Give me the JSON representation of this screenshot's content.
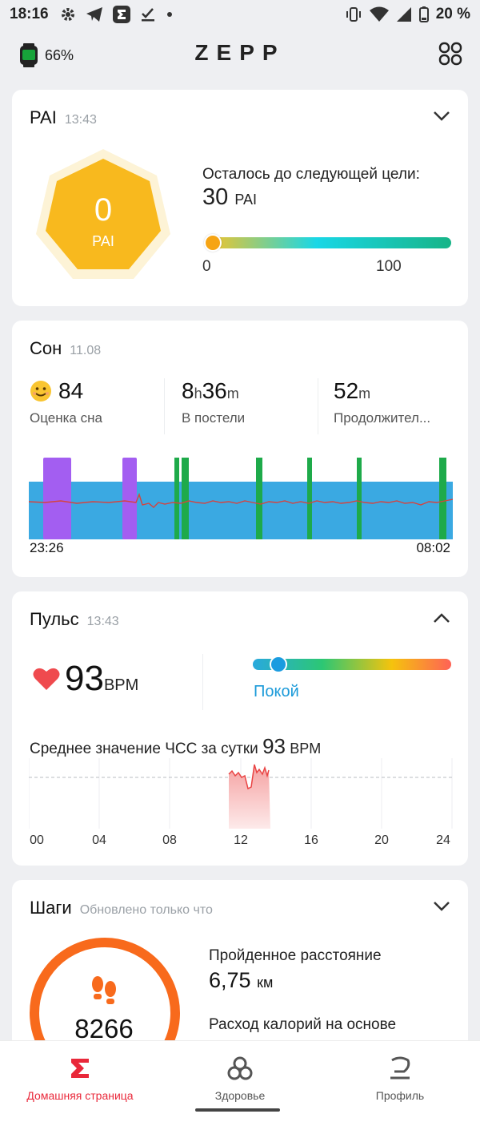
{
  "status": {
    "time": "18:16",
    "battery": "20 %"
  },
  "header": {
    "logo": "ZEPP",
    "watch_battery": "66%"
  },
  "pai": {
    "title": "PAI",
    "time": "13:43",
    "value": "0",
    "unit": "PAI",
    "goal_text": "Осталось до следующей цели:",
    "goal_value": "30",
    "goal_unit": "PAI",
    "scale_min": "0",
    "scale_max": "100"
  },
  "sleep": {
    "title": "Сон",
    "date": "11.08",
    "score": "84",
    "score_label": "Оценка сна",
    "bed_h": "8",
    "bed_h_unit": "h",
    "bed_m": "36",
    "bed_m_unit": "m",
    "bed_label": "В постели",
    "dur_m": "52",
    "dur_m_unit": "m",
    "dur_label": "Продолжител...",
    "start": "23:26",
    "end": "08:02"
  },
  "pulse": {
    "title": "Пульс",
    "time": "13:43",
    "bpm": "93",
    "bpm_unit": "BPM",
    "state": "Покой",
    "avg_text": "Среднее значение ЧСС за сутки",
    "avg_value": "93",
    "avg_unit": "BPM",
    "x_ticks": [
      "00",
      "04",
      "08",
      "12",
      "16",
      "20",
      "24"
    ]
  },
  "steps": {
    "title": "Шаги",
    "updated": "Обновлено только что",
    "count": "8266",
    "distance_label": "Пройденное расстояние",
    "distance_value": "6,75",
    "distance_unit": "км",
    "calories_label": "Расход калорий на основе"
  },
  "nav": {
    "home": "Домашняя страница",
    "health": "Здоровье",
    "profile": "Профиль"
  },
  "colors": {
    "accent": "#e9283a",
    "pai_yellow": "#f8b91e",
    "steps_orange": "#f86a1c",
    "sleep_light": "#3aa9e2",
    "sleep_rem": "#a35ef1",
    "sleep_awake": "#1eaa4a"
  }
}
